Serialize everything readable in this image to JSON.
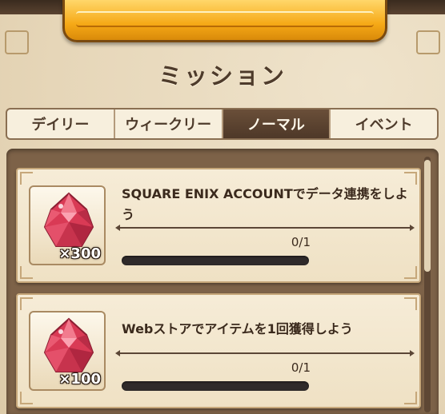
{
  "screen": {
    "title": "ミッション"
  },
  "tabs": [
    {
      "label": "デイリー",
      "active": false
    },
    {
      "label": "ウィークリー",
      "active": false
    },
    {
      "label": "ノーマル",
      "active": true
    },
    {
      "label": "イベント",
      "active": false
    }
  ],
  "missions": [
    {
      "title": "SQUARE ENIX ACCOUNTでデータ連携をしよう",
      "reward_qty": "×300",
      "reward_icon": "red-gem-icon",
      "progress_text": "0/1",
      "progress": 0
    },
    {
      "title": "Webストアでアイテムを1回獲得しよう",
      "reward_qty": "×100",
      "reward_icon": "red-gem-icon",
      "progress_text": "0/1",
      "progress": 0
    }
  ],
  "colors": {
    "banner": "#f6a916",
    "active_tab": "#4e3828",
    "gem": "#e0455c"
  }
}
